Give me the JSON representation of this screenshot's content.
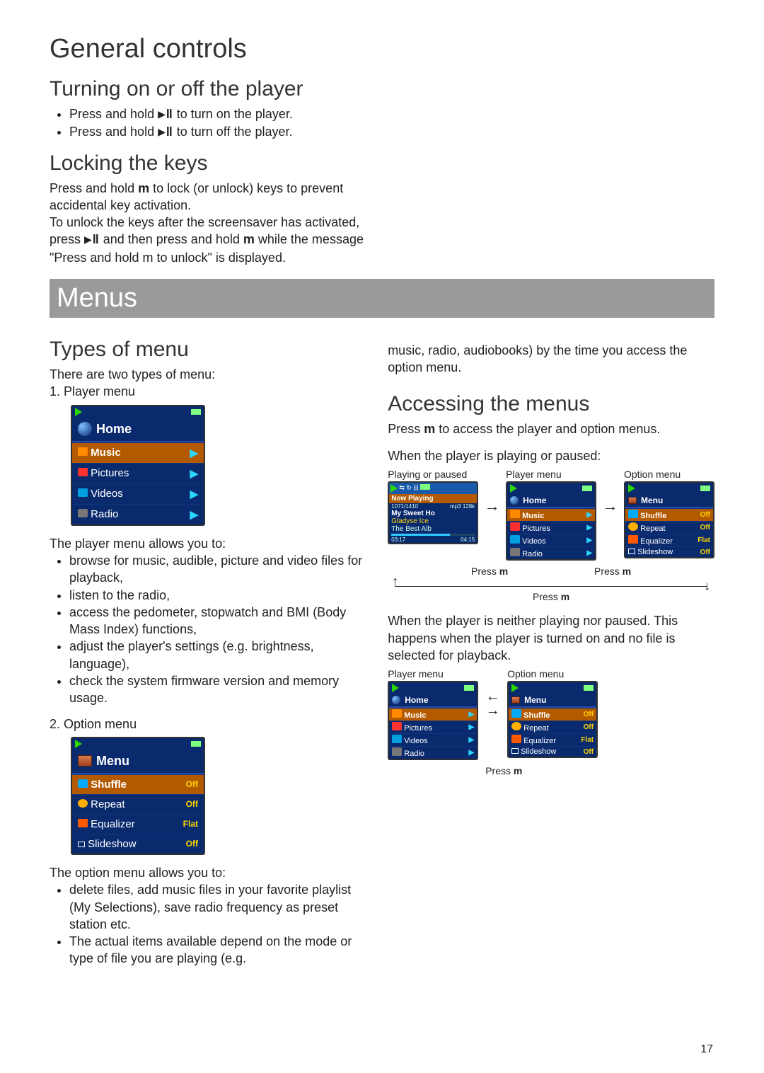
{
  "page_number": "17",
  "section1": {
    "title": "General controls",
    "sub1": {
      "heading": "Turning on or off the player",
      "b1a": "Press and hold ",
      "b1b": " to turn on the player.",
      "b2a": "Press and hold ",
      "b2b": " to turn off the player.",
      "pp_icon": "▶ǁ"
    },
    "sub2": {
      "heading": "Locking the keys",
      "p1a": "Press and hold ",
      "p1b": " to lock (or unlock) keys to prevent accidental key activation.",
      "p2a": "To unlock the keys after the screensaver has activated, press ",
      "p2b": " and then press and hold ",
      "p2c": " while the message \"Press and hold m to unlock\" is displayed.",
      "m": "m",
      "pp_icon": "▶ǁ"
    }
  },
  "section2": {
    "title": "Menus",
    "types": {
      "heading": "Types of menu",
      "intro": "There are two types of menu:",
      "item1": "Player menu",
      "item2": "Option menu",
      "player_intro": "The player menu allows you to:",
      "player_b1": "browse for music, audible, picture and video files for playback,",
      "player_b2": "listen to the radio,",
      "player_b3": "access the pedometer, stopwatch and BMI (Body Mass Index) functions,",
      "player_b4": "adjust the player's settings (e.g. brightness, language),",
      "player_b5": "check the system firmware version and memory usage.",
      "option_intro": "The option menu allows you to:",
      "option_b1": "delete files, add music files in your favorite playlist (My Selections), save radio frequency as preset station etc.",
      "option_b2": "The actual items available depend on the mode or type of file you are playing (e.g.",
      "option_cont": "music, radio, audiobooks) by the time you access the option menu."
    },
    "access": {
      "heading": "Accessing the menus",
      "p1a": "Press ",
      "p1b": " to access the player and option menus.",
      "m": "m",
      "p2": "When the player is playing or paused:",
      "p3": "When the player is neither playing nor paused. This happens when the player is turned on and no file is selected for playback.",
      "labels": {
        "playing": "Playing or paused",
        "player_menu": "Player menu",
        "option_menu": "Option menu",
        "press_m": "Press m",
        "m": "m",
        "press": "Press "
      }
    }
  },
  "device": {
    "home": {
      "title": "Home",
      "rows": [
        "Music",
        "Pictures",
        "Videos",
        "Radio"
      ]
    },
    "menu": {
      "title": "Menu",
      "rows": [
        {
          "label": "Shuffle",
          "val": "Off"
        },
        {
          "label": "Repeat",
          "val": "Off"
        },
        {
          "label": "Equalizer",
          "val": "Flat"
        },
        {
          "label": "Slideshow",
          "val": "Off"
        }
      ]
    },
    "now_playing": {
      "title": "Now Playing",
      "counts_left": "1071/1410",
      "counts_right": "mp3 128k",
      "song": "My Sweet Ho",
      "artist1": "Gladyse Ice",
      "artist2": "The Best Alb",
      "t_left": "03:17",
      "t_right": "04:15"
    }
  }
}
